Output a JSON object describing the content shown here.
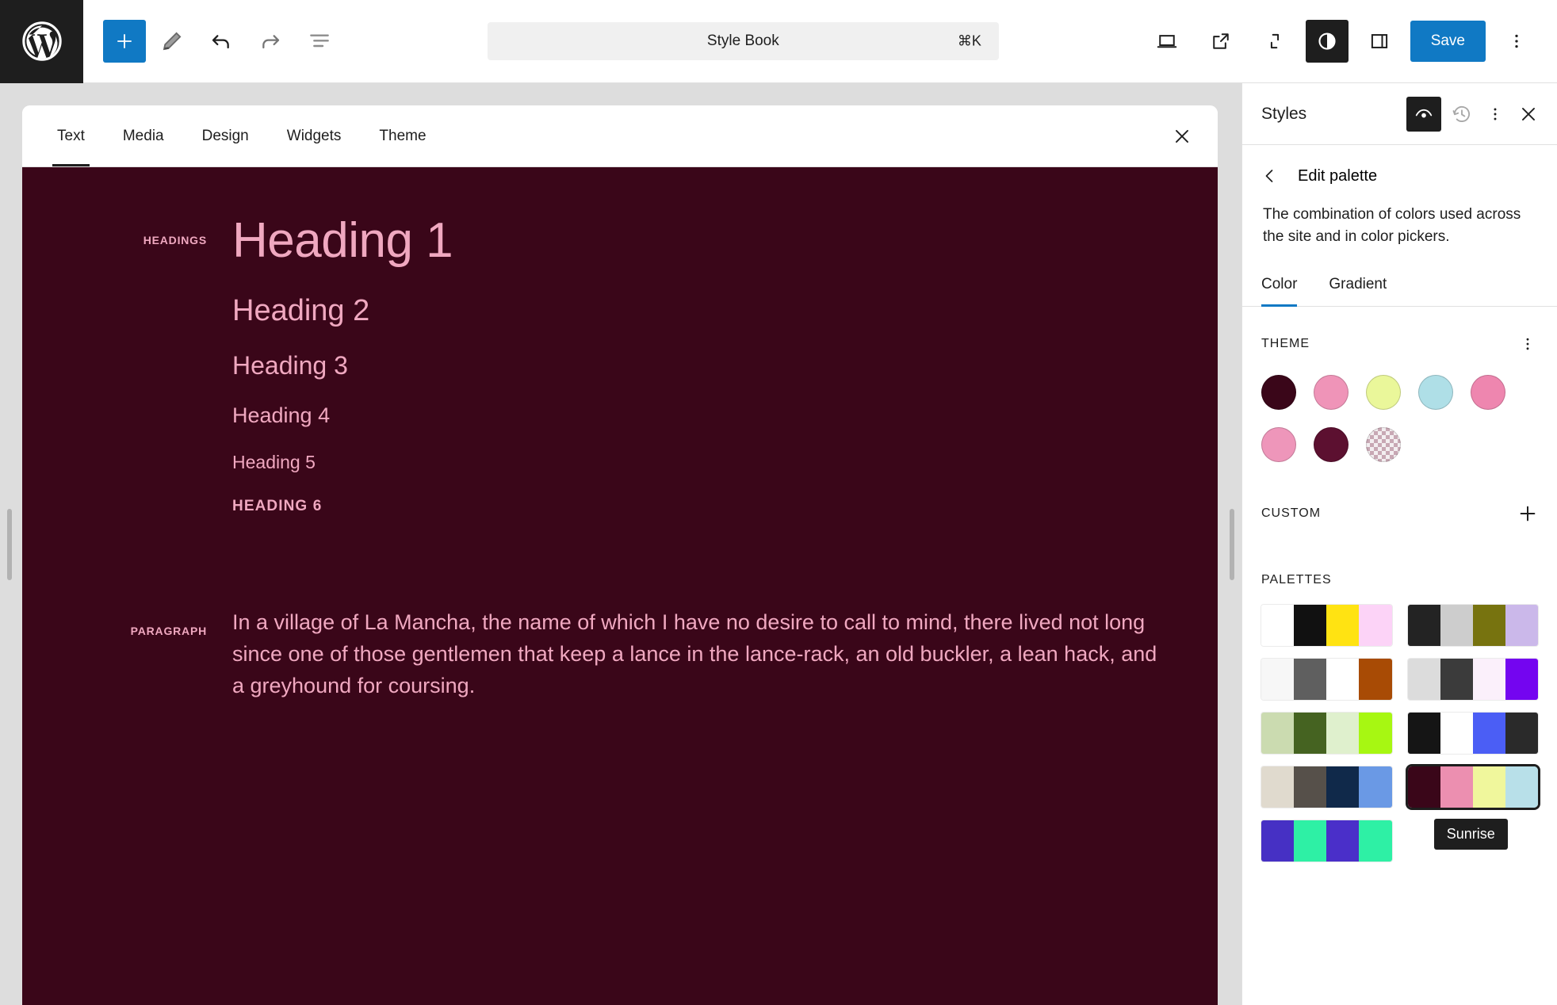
{
  "topbar": {
    "logo_icon": "wordpress-logo-icon",
    "left_tools": [
      {
        "name": "block-inserter-button",
        "icon": "plus-icon",
        "label": "Add block"
      },
      {
        "name": "tools-button",
        "icon": "pencil-icon",
        "label": "Tools"
      },
      {
        "name": "undo-button",
        "icon": "undo-icon",
        "label": "Undo"
      },
      {
        "name": "redo-button",
        "icon": "redo-icon",
        "label": "Redo"
      },
      {
        "name": "document-overview-button",
        "icon": "list-view-icon",
        "label": "Document Overview"
      }
    ],
    "command_bar": {
      "title": "Style Book",
      "shortcut": "⌘K"
    },
    "right_tools": [
      {
        "name": "view-device-button",
        "icon": "laptop-icon",
        "label": "View"
      },
      {
        "name": "view-site-button",
        "icon": "external-link-icon",
        "label": "View site"
      },
      {
        "name": "zoom-out-button",
        "icon": "expand-icon",
        "label": "Zoom out"
      },
      {
        "name": "styles-button",
        "icon": "contrast-circle-icon",
        "label": "Styles"
      },
      {
        "name": "settings-sidebar-button",
        "icon": "sidebar-panel-icon",
        "label": "Settings"
      }
    ],
    "save_label": "Save",
    "more_menu_icon": "kebab-vertical-icon",
    "accent": "#1079c4"
  },
  "stylebook": {
    "tabs": [
      {
        "label": "Text",
        "active": true
      },
      {
        "label": "Media",
        "active": false
      },
      {
        "label": "Design",
        "active": false
      },
      {
        "label": "Widgets",
        "active": false
      },
      {
        "label": "Theme",
        "active": false
      }
    ],
    "close_icon": "close-icon",
    "background": "#3a0619",
    "text_color": "#f0a8c0",
    "sections": [
      {
        "label": "HEADINGS",
        "headings": [
          "Heading 1",
          "Heading 2",
          "Heading 3",
          "Heading 4",
          "Heading 5",
          "HEADING 6"
        ]
      },
      {
        "label": "PARAGRAPH",
        "paragraph": "In a village of La Mancha, the name of which I have no desire to call to mind, there lived not long since one of those gentlemen that keep a lance in the lance-rack, an old buckler, a lean hack, and a greyhound for coursing."
      }
    ]
  },
  "styles_panel": {
    "title": "Styles",
    "header_actions": [
      {
        "name": "style-book-toggle",
        "icon": "eye-icon",
        "active": true
      },
      {
        "name": "revisions-button",
        "icon": "history-clock-icon",
        "active": false
      },
      {
        "name": "styles-more-menu",
        "icon": "kebab-vertical-icon",
        "active": false
      },
      {
        "name": "close-styles-button",
        "icon": "close-icon",
        "active": false
      }
    ],
    "back_icon": "chevron-left-icon",
    "nav_title": "Edit palette",
    "description": "The combination of colors used across the site and in color pickers.",
    "tabs": [
      {
        "label": "Color",
        "active": true
      },
      {
        "label": "Gradient",
        "active": false
      }
    ],
    "theme": {
      "title": "THEME",
      "menu_icon": "kebab-vertical-icon",
      "swatches": [
        {
          "name": "theme-color-base",
          "color": "#3a0619"
        },
        {
          "name": "theme-color-contrast",
          "color": "#ef94b8"
        },
        {
          "name": "theme-color-accent-1",
          "color": "#eaf79a"
        },
        {
          "name": "theme-color-accent-2",
          "color": "#afdfe7"
        },
        {
          "name": "theme-color-accent-3",
          "color": "#ee86af"
        },
        {
          "name": "theme-color-accent-4",
          "color": "#ee96ba"
        },
        {
          "name": "theme-color-accent-5",
          "color": "#5c1030"
        },
        {
          "name": "theme-color-transparent",
          "color": "transparent"
        }
      ]
    },
    "custom": {
      "title": "CUSTOM",
      "add_icon": "plus-icon"
    },
    "palettes": {
      "title": "PALETTES",
      "items": [
        {
          "name": "palette-1",
          "colors": [
            "#ffffff",
            "#111111",
            "#ffe312",
            "#fcd3f7"
          ],
          "selected": false
        },
        {
          "name": "palette-2",
          "colors": [
            "#232323",
            "#cdcdcd",
            "#77730f",
            "#cbb8ea"
          ],
          "selected": false
        },
        {
          "name": "palette-3",
          "colors": [
            "#f7f7f7",
            "#5f5f5f",
            "#ffffff",
            "#a84b05"
          ],
          "selected": false
        },
        {
          "name": "palette-4",
          "colors": [
            "#dcdcdc",
            "#3b3b3b",
            "#fbf0fb",
            "#7405f0"
          ],
          "selected": false
        },
        {
          "name": "palette-5",
          "colors": [
            "#cbdbb0",
            "#456321",
            "#dff0cd",
            "#a7f712"
          ],
          "selected": false
        },
        {
          "name": "palette-6",
          "colors": [
            "#151515",
            "#ffffff",
            "#4b5ef5",
            "#2a2a2a"
          ],
          "selected": false
        },
        {
          "name": "palette-7",
          "colors": [
            "#e0dace",
            "#56504a",
            "#10294a",
            "#6a99e5"
          ],
          "selected": false
        },
        {
          "name": "palette-sunrise",
          "colors": [
            "#3a0619",
            "#ec8fb0",
            "#f0f79c",
            "#b8e0e9"
          ],
          "selected": true
        },
        {
          "name": "palette-8",
          "colors": [
            "#4630c4",
            "#2ef0a5",
            "#4a2fc9",
            "#2ef0a5"
          ],
          "selected": false
        }
      ],
      "tooltip": "Sunrise"
    }
  }
}
